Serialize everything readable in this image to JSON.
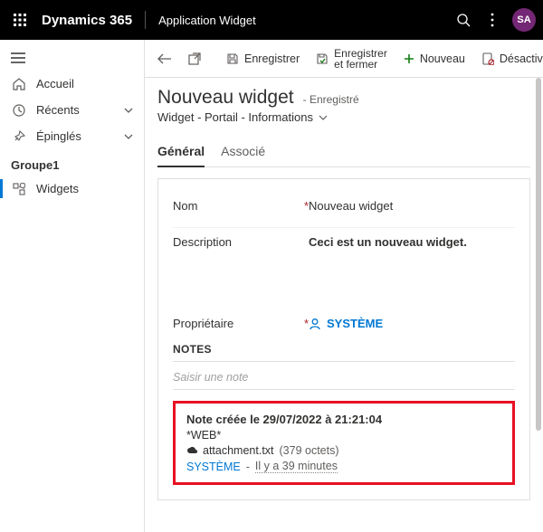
{
  "topbar": {
    "brand": "Dynamics 365",
    "app": "Application Widget",
    "avatar": "SA"
  },
  "sidebar": {
    "home": "Accueil",
    "recent": "Récents",
    "pinned": "Épinglés",
    "group1": "Groupe1",
    "widgets": "Widgets"
  },
  "commands": {
    "save": "Enregistrer",
    "saveclose_l1": "Enregistrer",
    "saveclose_l2": "et fermer",
    "new": "Nouveau",
    "deactivate": "Désactiver"
  },
  "header": {
    "title": "Nouveau widget",
    "status": "- Enregistré",
    "crumb": "Widget - Portail - Informations"
  },
  "tabs": {
    "general": "Général",
    "related": "Associé"
  },
  "form": {
    "name_label": "Nom",
    "name_value": "Nouveau widget",
    "desc_label": "Description",
    "desc_value": "Ceci est un nouveau widget.",
    "owner_label": "Propriétaire",
    "owner_value": "SYSTÈME"
  },
  "notes": {
    "heading": "NOTES",
    "placeholder": "Saisir une note",
    "item": {
      "title": "Note créée le 29/07/2022 à 21:21:04",
      "tag": "*WEB*",
      "attachment_name": "attachment.txt",
      "attachment_size": "(379 octets)",
      "author": "SYSTÈME",
      "sep": " - ",
      "age": "Il y a 39 minutes"
    }
  }
}
